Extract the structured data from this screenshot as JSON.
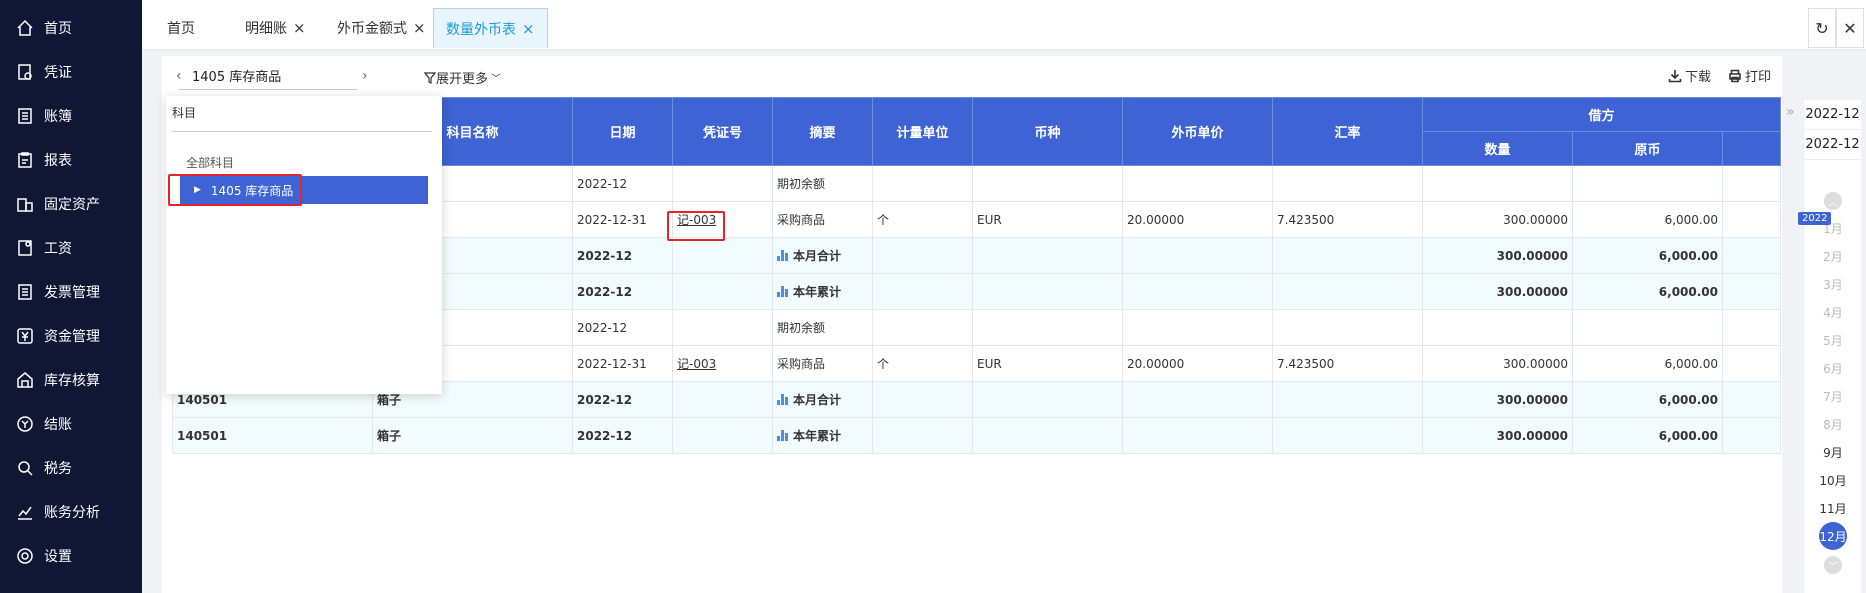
{
  "sidebar": {
    "items": [
      {
        "label": "首页",
        "icon": "home-icon"
      },
      {
        "label": "凭证",
        "icon": "voucher-icon"
      },
      {
        "label": "账簿",
        "icon": "ledger-icon"
      },
      {
        "label": "报表",
        "icon": "report-icon"
      },
      {
        "label": "固定资产",
        "icon": "fixed-asset-icon"
      },
      {
        "label": "工资",
        "icon": "salary-icon"
      },
      {
        "label": "发票管理",
        "icon": "invoice-icon"
      },
      {
        "label": "资金管理",
        "icon": "yuan-icon"
      },
      {
        "label": "库存核算",
        "icon": "inventory-icon"
      },
      {
        "label": "结账",
        "icon": "close-books-icon"
      },
      {
        "label": "税务",
        "icon": "tax-icon"
      },
      {
        "label": "账务分析",
        "icon": "chart-line-icon"
      },
      {
        "label": "设置",
        "icon": "gear-icon"
      }
    ]
  },
  "tabs": {
    "home": "首页",
    "detail": "明细账",
    "fx_amount": "外币金额式",
    "qty_fx": "数量外币表",
    "close": "×",
    "refresh": "↻",
    "close_all": "✕"
  },
  "toolbar": {
    "account_select": "1405  库存商品",
    "prev": "‹",
    "next": "›",
    "expand_more": "展开更多",
    "download": "下载",
    "print": "打印"
  },
  "dropdown": {
    "header": "科目",
    "all": "全部科目",
    "selected": "1405 库存商品"
  },
  "table": {
    "headers": {
      "code": "",
      "name": "科目名称",
      "date": "日期",
      "voucher": "凭证号",
      "summary": "摘要",
      "unit": "计量单位",
      "currency": "币种",
      "fx_price": "外币单价",
      "rate": "汇率",
      "debit": "借方",
      "qty": "数量",
      "orig": "原币"
    },
    "rows": [
      {
        "code": "",
        "name": "",
        "date": "2022-12",
        "voucher": "",
        "summary": "期初余额",
        "unit": "",
        "currency": "",
        "price": "",
        "rate": "",
        "qty": "",
        "orig": "",
        "sum": false
      },
      {
        "code": "",
        "name": "",
        "date": "2022-12-31",
        "voucher": "记-003",
        "summary": "采购商品",
        "unit": "个",
        "currency": "EUR",
        "price": "20.00000",
        "rate": "7.423500",
        "qty": "300.00000",
        "orig": "6,000.00",
        "sum": false
      },
      {
        "code": "",
        "name": "",
        "date": "2022-12",
        "voucher": "",
        "summary": "本月合计",
        "unit": "",
        "currency": "",
        "price": "",
        "rate": "",
        "qty": "300.00000",
        "orig": "6,000.00",
        "sum": true
      },
      {
        "code": "",
        "name": "",
        "date": "2022-12",
        "voucher": "",
        "summary": "本年累计",
        "unit": "",
        "currency": "",
        "price": "",
        "rate": "",
        "qty": "300.00000",
        "orig": "6,000.00",
        "sum": true
      },
      {
        "code": "",
        "name": "",
        "date": "2022-12",
        "voucher": "",
        "summary": "期初余额",
        "unit": "",
        "currency": "",
        "price": "",
        "rate": "",
        "qty": "",
        "orig": "",
        "sum": false
      },
      {
        "code": "",
        "name": "",
        "date": "2022-12-31",
        "voucher": "记-003",
        "summary": "采购商品",
        "unit": "个",
        "currency": "EUR",
        "price": "20.00000",
        "rate": "7.423500",
        "qty": "300.00000",
        "orig": "6,000.00",
        "sum": false
      },
      {
        "code": "140501",
        "name": "箱子",
        "date": "2022-12",
        "voucher": "",
        "summary": "本月合计",
        "unit": "",
        "currency": "",
        "price": "",
        "rate": "",
        "qty": "300.00000",
        "orig": "6,000.00",
        "sum": true
      },
      {
        "code": "140501",
        "name": "箱子",
        "date": "2022-12",
        "voucher": "",
        "summary": "本年累计",
        "unit": "",
        "currency": "",
        "price": "",
        "rate": "",
        "qty": "300.00000",
        "orig": "6,000.00",
        "sum": true
      }
    ]
  },
  "period": {
    "start": "2022-12",
    "end": "2022-12",
    "year": "2022",
    "months": [
      "1月",
      "2月",
      "3月",
      "4月",
      "5月",
      "6月",
      "7月",
      "8月",
      "9月",
      "10月",
      "11月",
      "12月"
    ],
    "enabled_from": 8,
    "current": 11
  },
  "colors": {
    "sidebar_bg": "#0f1735",
    "header_blue": "#3d63d4",
    "highlight_red": "#e0262a",
    "tab_active": "#1e9ad6"
  }
}
